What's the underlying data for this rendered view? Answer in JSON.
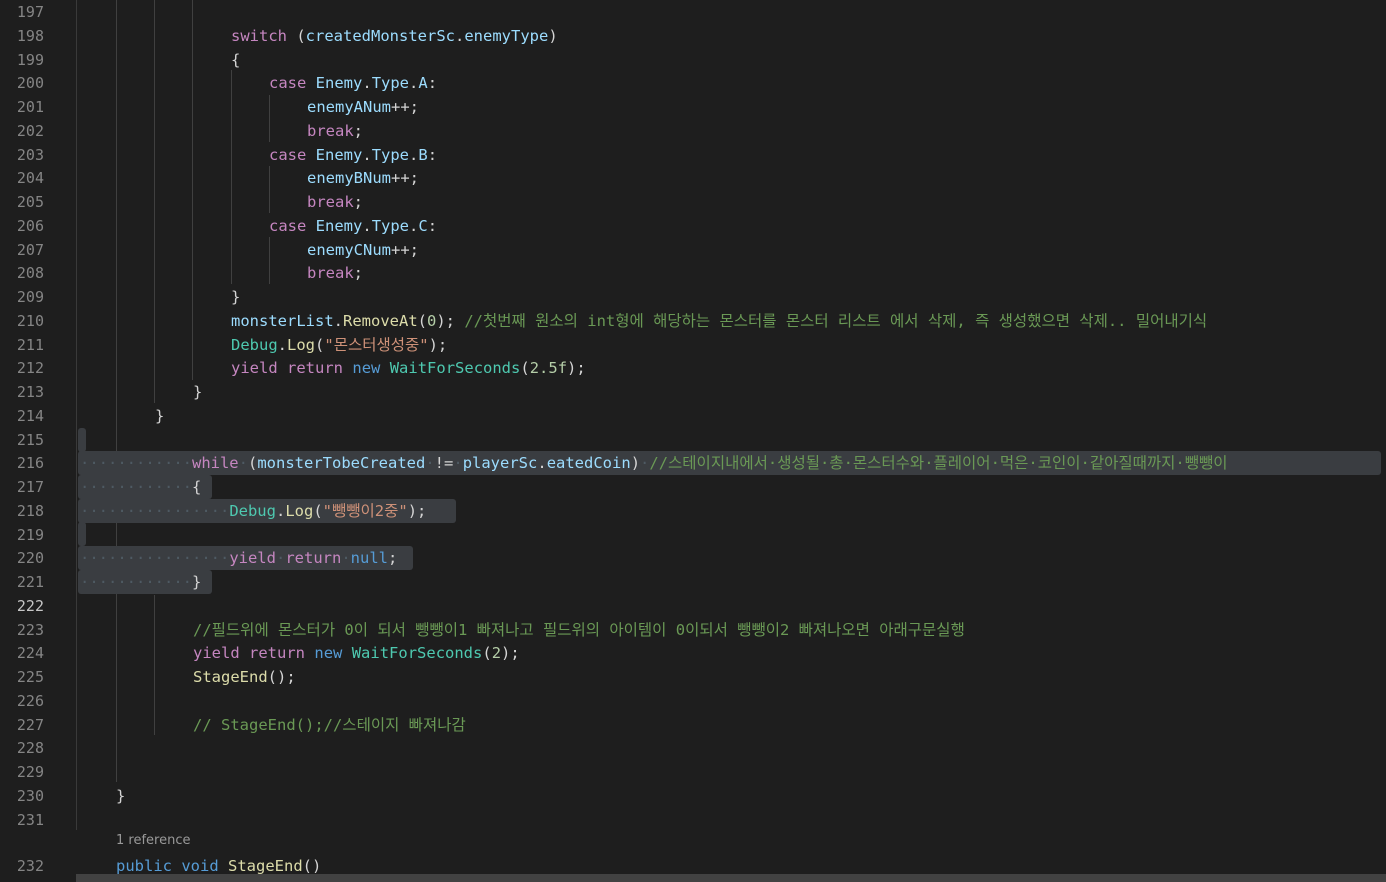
{
  "editor": {
    "lines": [
      {
        "n": "197",
        "indent": 0,
        "tokens": []
      },
      {
        "n": "198",
        "indent": 231,
        "tokens": [
          {
            "t": "switch",
            "c": "kw"
          },
          {
            "t": " (",
            "c": "punc"
          },
          {
            "t": "createdMonsterSc",
            "c": "var"
          },
          {
            "t": ".",
            "c": "punc"
          },
          {
            "t": "enemyType",
            "c": "var"
          },
          {
            "t": ")",
            "c": "punc"
          }
        ]
      },
      {
        "n": "199",
        "indent": 231,
        "tokens": [
          {
            "t": "{",
            "c": "punc"
          }
        ]
      },
      {
        "n": "200",
        "indent": 269,
        "tokens": [
          {
            "t": "case",
            "c": "kw"
          },
          {
            "t": " ",
            "c": "punc"
          },
          {
            "t": "Enemy",
            "c": "var"
          },
          {
            "t": ".",
            "c": "punc"
          },
          {
            "t": "Type",
            "c": "var"
          },
          {
            "t": ".",
            "c": "punc"
          },
          {
            "t": "A",
            "c": "var"
          },
          {
            "t": ":",
            "c": "punc"
          }
        ]
      },
      {
        "n": "201",
        "indent": 307,
        "tokens": [
          {
            "t": "enemyANum",
            "c": "var"
          },
          {
            "t": "++;",
            "c": "punc"
          }
        ]
      },
      {
        "n": "202",
        "indent": 307,
        "tokens": [
          {
            "t": "break",
            "c": "kw"
          },
          {
            "t": ";",
            "c": "punc"
          }
        ]
      },
      {
        "n": "203",
        "indent": 269,
        "tokens": [
          {
            "t": "case",
            "c": "kw"
          },
          {
            "t": " ",
            "c": "punc"
          },
          {
            "t": "Enemy",
            "c": "var"
          },
          {
            "t": ".",
            "c": "punc"
          },
          {
            "t": "Type",
            "c": "var"
          },
          {
            "t": ".",
            "c": "punc"
          },
          {
            "t": "B",
            "c": "var"
          },
          {
            "t": ":",
            "c": "punc"
          }
        ]
      },
      {
        "n": "204",
        "indent": 307,
        "tokens": [
          {
            "t": "enemyBNum",
            "c": "var"
          },
          {
            "t": "++;",
            "c": "punc"
          }
        ]
      },
      {
        "n": "205",
        "indent": 307,
        "tokens": [
          {
            "t": "break",
            "c": "kw"
          },
          {
            "t": ";",
            "c": "punc"
          }
        ]
      },
      {
        "n": "206",
        "indent": 269,
        "tokens": [
          {
            "t": "case",
            "c": "kw"
          },
          {
            "t": " ",
            "c": "punc"
          },
          {
            "t": "Enemy",
            "c": "var"
          },
          {
            "t": ".",
            "c": "punc"
          },
          {
            "t": "Type",
            "c": "var"
          },
          {
            "t": ".",
            "c": "punc"
          },
          {
            "t": "C",
            "c": "var"
          },
          {
            "t": ":",
            "c": "punc"
          }
        ]
      },
      {
        "n": "207",
        "indent": 307,
        "tokens": [
          {
            "t": "enemyCNum",
            "c": "var"
          },
          {
            "t": "++;",
            "c": "punc"
          }
        ]
      },
      {
        "n": "208",
        "indent": 307,
        "tokens": [
          {
            "t": "break",
            "c": "kw"
          },
          {
            "t": ";",
            "c": "punc"
          }
        ]
      },
      {
        "n": "209",
        "indent": 231,
        "tokens": [
          {
            "t": "}",
            "c": "punc"
          }
        ]
      },
      {
        "n": "210",
        "indent": 231,
        "tokens": [
          {
            "t": "monsterList",
            "c": "var"
          },
          {
            "t": ".",
            "c": "punc"
          },
          {
            "t": "RemoveAt",
            "c": "fn"
          },
          {
            "t": "(",
            "c": "punc"
          },
          {
            "t": "0",
            "c": "num"
          },
          {
            "t": "); ",
            "c": "punc"
          },
          {
            "t": "//첫번째 원소의 int형에 해당하는 몬스터를 몬스터 리스트 에서 삭제, 즉 생성했으면 삭제.. 밀어내기식",
            "c": "cmt"
          }
        ]
      },
      {
        "n": "211",
        "indent": 231,
        "tokens": [
          {
            "t": "Debug",
            "c": "type"
          },
          {
            "t": ".",
            "c": "punc"
          },
          {
            "t": "Log",
            "c": "fn"
          },
          {
            "t": "(",
            "c": "punc"
          },
          {
            "t": "\"몬스터생성중\"",
            "c": "str"
          },
          {
            "t": ");",
            "c": "punc"
          }
        ]
      },
      {
        "n": "212",
        "indent": 231,
        "tokens": [
          {
            "t": "yield",
            "c": "kw"
          },
          {
            "t": " ",
            "c": "punc"
          },
          {
            "t": "return",
            "c": "kw"
          },
          {
            "t": " ",
            "c": "punc"
          },
          {
            "t": "new",
            "c": "kw2"
          },
          {
            "t": " ",
            "c": "punc"
          },
          {
            "t": "WaitForSeconds",
            "c": "type"
          },
          {
            "t": "(",
            "c": "punc"
          },
          {
            "t": "2.5f",
            "c": "num"
          },
          {
            "t": ");",
            "c": "punc"
          }
        ]
      },
      {
        "n": "213",
        "indent": 193,
        "tokens": [
          {
            "t": "}",
            "c": "punc"
          }
        ]
      },
      {
        "n": "214",
        "indent": 155,
        "tokens": [
          {
            "t": "}",
            "c": "punc"
          }
        ]
      },
      {
        "n": "215",
        "indent": 0,
        "tokens": []
      },
      {
        "n": "216",
        "indent": 80,
        "tokens": [
          {
            "t": "············",
            "c": "ws"
          },
          {
            "t": "while",
            "c": "kw"
          },
          {
            "t": "·",
            "c": "ws"
          },
          {
            "t": "(",
            "c": "punc"
          },
          {
            "t": "monsterTobeCreated",
            "c": "var"
          },
          {
            "t": "·",
            "c": "ws"
          },
          {
            "t": "!=",
            "c": "punc"
          },
          {
            "t": "·",
            "c": "ws"
          },
          {
            "t": "playerSc",
            "c": "var"
          },
          {
            "t": ".",
            "c": "punc"
          },
          {
            "t": "eatedCoin",
            "c": "var"
          },
          {
            "t": ")",
            "c": "punc"
          },
          {
            "t": "·",
            "c": "ws"
          },
          {
            "t": "//스테이지내에서·생성될·총·몬스터수와·플레이어·먹은·코인이·같아질때까지·뺑뺑이",
            "c": "cmt"
          }
        ]
      },
      {
        "n": "217",
        "indent": 80,
        "tokens": [
          {
            "t": "············",
            "c": "ws"
          },
          {
            "t": "{",
            "c": "punc"
          }
        ]
      },
      {
        "n": "218",
        "indent": 80,
        "tokens": [
          {
            "t": "················",
            "c": "ws"
          },
          {
            "t": "Debug",
            "c": "type"
          },
          {
            "t": ".",
            "c": "punc"
          },
          {
            "t": "Log",
            "c": "fn"
          },
          {
            "t": "(",
            "c": "punc"
          },
          {
            "t": "\"뺑뺑이2중\"",
            "c": "str"
          },
          {
            "t": ");",
            "c": "punc"
          }
        ]
      },
      {
        "n": "219",
        "indent": 0,
        "tokens": []
      },
      {
        "n": "220",
        "indent": 80,
        "tokens": [
          {
            "t": "················",
            "c": "ws"
          },
          {
            "t": "yield",
            "c": "kw"
          },
          {
            "t": "·",
            "c": "ws"
          },
          {
            "t": "return",
            "c": "kw"
          },
          {
            "t": "·",
            "c": "ws"
          },
          {
            "t": "null",
            "c": "kw2"
          },
          {
            "t": ";",
            "c": "punc"
          }
        ]
      },
      {
        "n": "221",
        "indent": 80,
        "tokens": [
          {
            "t": "············",
            "c": "ws"
          },
          {
            "t": "}",
            "c": "punc"
          }
        ]
      },
      {
        "n": "222",
        "indent": 0,
        "tokens": [],
        "active": true
      },
      {
        "n": "223",
        "indent": 193,
        "tokens": [
          {
            "t": "//필드위에 몬스터가 0이 되서 뺑뺑이1 빠져나고 필드위의 아이템이 0이되서 뺑뺑이2 빠져나오면 아래구문실행",
            "c": "cmt"
          }
        ]
      },
      {
        "n": "224",
        "indent": 193,
        "tokens": [
          {
            "t": "yield",
            "c": "kw"
          },
          {
            "t": " ",
            "c": "punc"
          },
          {
            "t": "return",
            "c": "kw"
          },
          {
            "t": " ",
            "c": "punc"
          },
          {
            "t": "new",
            "c": "kw2"
          },
          {
            "t": " ",
            "c": "punc"
          },
          {
            "t": "WaitForSeconds",
            "c": "type"
          },
          {
            "t": "(",
            "c": "punc"
          },
          {
            "t": "2",
            "c": "num"
          },
          {
            "t": ");",
            "c": "punc"
          }
        ]
      },
      {
        "n": "225",
        "indent": 193,
        "tokens": [
          {
            "t": "StageEnd",
            "c": "fn"
          },
          {
            "t": "();",
            "c": "punc"
          }
        ]
      },
      {
        "n": "226",
        "indent": 0,
        "tokens": []
      },
      {
        "n": "227",
        "indent": 193,
        "tokens": [
          {
            "t": "// StageEnd();//스테이지 빠져나감",
            "c": "cmt"
          }
        ]
      },
      {
        "n": "228",
        "indent": 0,
        "tokens": []
      },
      {
        "n": "229",
        "indent": 0,
        "tokens": []
      },
      {
        "n": "230",
        "indent": 116,
        "tokens": [
          {
            "t": "}",
            "c": "punc"
          }
        ]
      },
      {
        "n": "231",
        "indent": 0,
        "tokens": []
      }
    ],
    "codelens": "1 reference",
    "last_line": {
      "n": "232",
      "indent": 116,
      "tokens": [
        {
          "t": "public",
          "c": "kw2"
        },
        {
          "t": " ",
          "c": "punc"
        },
        {
          "t": "void",
          "c": "kw2"
        },
        {
          "t": " ",
          "c": "punc"
        },
        {
          "t": "StageEnd",
          "c": "fn"
        },
        {
          "t": "()",
          "c": "punc"
        }
      ]
    }
  },
  "colors": {
    "background": "#1e1e1e",
    "keyword": "#c586c0",
    "keyword_blue": "#569cd6",
    "type": "#4ec9b0",
    "variable": "#9cdcfe",
    "function": "#dcdcaa",
    "string": "#ce9178",
    "number": "#b5cea8",
    "comment": "#6a9955",
    "selection": "#3a3d41"
  }
}
